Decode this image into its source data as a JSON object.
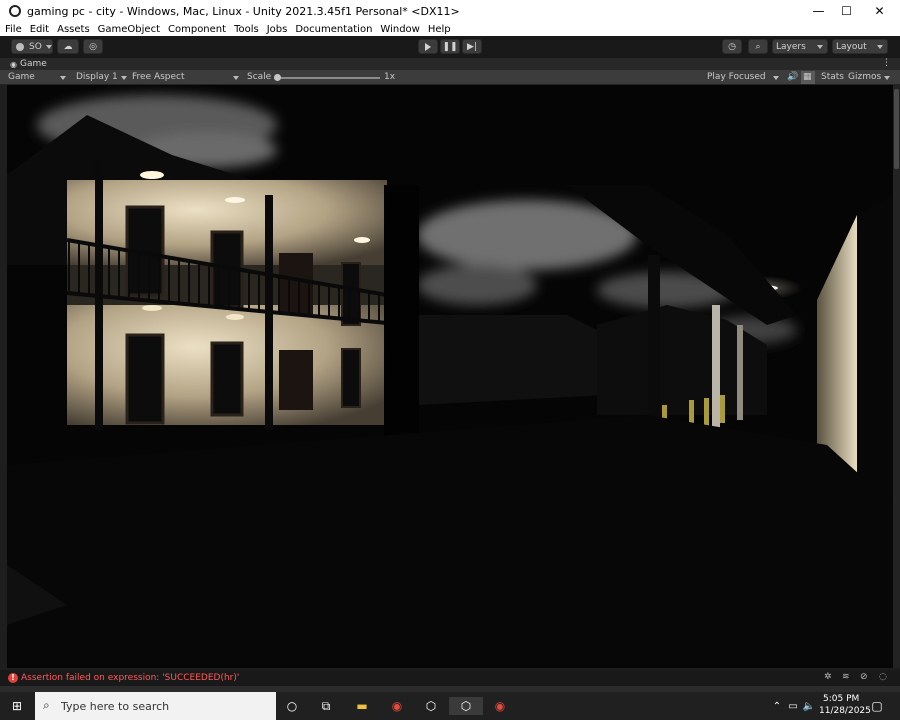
{
  "window": {
    "title": "gaming pc - city - Windows, Mac, Linux - Unity 2021.3.45f1 Personal* <DX11>"
  },
  "menu": {
    "items": [
      "File",
      "Edit",
      "Assets",
      "GameObject",
      "Component",
      "Tools",
      "Jobs",
      "Documentation",
      "Window",
      "Help"
    ]
  },
  "toolbar": {
    "account_label": "SO",
    "layers_label": "Layers",
    "layout_label": "Layout"
  },
  "tabs": {
    "game_tab_label": "Game"
  },
  "game_view": {
    "display_mode": "Game",
    "display": "Display 1",
    "aspect": "Free Aspect",
    "scale_label": "Scale",
    "scale_value": "1x",
    "scale_fraction": 0.0,
    "play_mode": "Play Focused",
    "stats_label": "Stats",
    "gizmos_label": "Gizmos"
  },
  "status": {
    "message": "Assertion failed on expression: 'SUCCEEDED(hr)'"
  },
  "taskbar": {
    "search_placeholder": "Type here to search",
    "time": "5:05 PM",
    "date": "11/28/2025"
  },
  "colors": {
    "accent_error": "#ff5a5a",
    "editor_bg": "#3c3c3c",
    "toolbar_bg": "#191919",
    "taskbar_bg": "#202020"
  }
}
